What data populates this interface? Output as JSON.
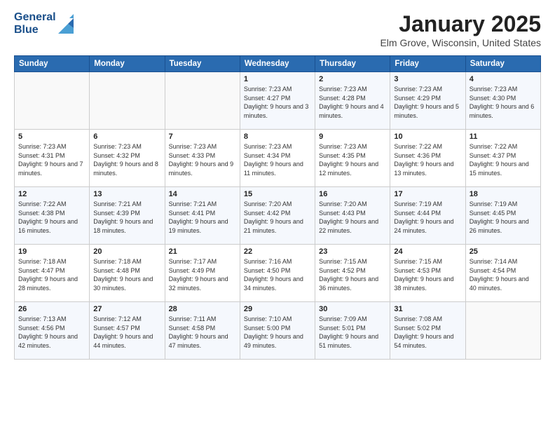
{
  "header": {
    "logo_line1": "General",
    "logo_line2": "Blue",
    "month_title": "January 2025",
    "location": "Elm Grove, Wisconsin, United States"
  },
  "days_of_week": [
    "Sunday",
    "Monday",
    "Tuesday",
    "Wednesday",
    "Thursday",
    "Friday",
    "Saturday"
  ],
  "weeks": [
    [
      {
        "day": "",
        "sunrise": "",
        "sunset": "",
        "daylight": ""
      },
      {
        "day": "",
        "sunrise": "",
        "sunset": "",
        "daylight": ""
      },
      {
        "day": "",
        "sunrise": "",
        "sunset": "",
        "daylight": ""
      },
      {
        "day": "1",
        "sunrise": "Sunrise: 7:23 AM",
        "sunset": "Sunset: 4:27 PM",
        "daylight": "Daylight: 9 hours and 3 minutes."
      },
      {
        "day": "2",
        "sunrise": "Sunrise: 7:23 AM",
        "sunset": "Sunset: 4:28 PM",
        "daylight": "Daylight: 9 hours and 4 minutes."
      },
      {
        "day": "3",
        "sunrise": "Sunrise: 7:23 AM",
        "sunset": "Sunset: 4:29 PM",
        "daylight": "Daylight: 9 hours and 5 minutes."
      },
      {
        "day": "4",
        "sunrise": "Sunrise: 7:23 AM",
        "sunset": "Sunset: 4:30 PM",
        "daylight": "Daylight: 9 hours and 6 minutes."
      }
    ],
    [
      {
        "day": "5",
        "sunrise": "Sunrise: 7:23 AM",
        "sunset": "Sunset: 4:31 PM",
        "daylight": "Daylight: 9 hours and 7 minutes."
      },
      {
        "day": "6",
        "sunrise": "Sunrise: 7:23 AM",
        "sunset": "Sunset: 4:32 PM",
        "daylight": "Daylight: 9 hours and 8 minutes."
      },
      {
        "day": "7",
        "sunrise": "Sunrise: 7:23 AM",
        "sunset": "Sunset: 4:33 PM",
        "daylight": "Daylight: 9 hours and 9 minutes."
      },
      {
        "day": "8",
        "sunrise": "Sunrise: 7:23 AM",
        "sunset": "Sunset: 4:34 PM",
        "daylight": "Daylight: 9 hours and 11 minutes."
      },
      {
        "day": "9",
        "sunrise": "Sunrise: 7:23 AM",
        "sunset": "Sunset: 4:35 PM",
        "daylight": "Daylight: 9 hours and 12 minutes."
      },
      {
        "day": "10",
        "sunrise": "Sunrise: 7:22 AM",
        "sunset": "Sunset: 4:36 PM",
        "daylight": "Daylight: 9 hours and 13 minutes."
      },
      {
        "day": "11",
        "sunrise": "Sunrise: 7:22 AM",
        "sunset": "Sunset: 4:37 PM",
        "daylight": "Daylight: 9 hours and 15 minutes."
      }
    ],
    [
      {
        "day": "12",
        "sunrise": "Sunrise: 7:22 AM",
        "sunset": "Sunset: 4:38 PM",
        "daylight": "Daylight: 9 hours and 16 minutes."
      },
      {
        "day": "13",
        "sunrise": "Sunrise: 7:21 AM",
        "sunset": "Sunset: 4:39 PM",
        "daylight": "Daylight: 9 hours and 18 minutes."
      },
      {
        "day": "14",
        "sunrise": "Sunrise: 7:21 AM",
        "sunset": "Sunset: 4:41 PM",
        "daylight": "Daylight: 9 hours and 19 minutes."
      },
      {
        "day": "15",
        "sunrise": "Sunrise: 7:20 AM",
        "sunset": "Sunset: 4:42 PM",
        "daylight": "Daylight: 9 hours and 21 minutes."
      },
      {
        "day": "16",
        "sunrise": "Sunrise: 7:20 AM",
        "sunset": "Sunset: 4:43 PM",
        "daylight": "Daylight: 9 hours and 22 minutes."
      },
      {
        "day": "17",
        "sunrise": "Sunrise: 7:19 AM",
        "sunset": "Sunset: 4:44 PM",
        "daylight": "Daylight: 9 hours and 24 minutes."
      },
      {
        "day": "18",
        "sunrise": "Sunrise: 7:19 AM",
        "sunset": "Sunset: 4:45 PM",
        "daylight": "Daylight: 9 hours and 26 minutes."
      }
    ],
    [
      {
        "day": "19",
        "sunrise": "Sunrise: 7:18 AM",
        "sunset": "Sunset: 4:47 PM",
        "daylight": "Daylight: 9 hours and 28 minutes."
      },
      {
        "day": "20",
        "sunrise": "Sunrise: 7:18 AM",
        "sunset": "Sunset: 4:48 PM",
        "daylight": "Daylight: 9 hours and 30 minutes."
      },
      {
        "day": "21",
        "sunrise": "Sunrise: 7:17 AM",
        "sunset": "Sunset: 4:49 PM",
        "daylight": "Daylight: 9 hours and 32 minutes."
      },
      {
        "day": "22",
        "sunrise": "Sunrise: 7:16 AM",
        "sunset": "Sunset: 4:50 PM",
        "daylight": "Daylight: 9 hours and 34 minutes."
      },
      {
        "day": "23",
        "sunrise": "Sunrise: 7:15 AM",
        "sunset": "Sunset: 4:52 PM",
        "daylight": "Daylight: 9 hours and 36 minutes."
      },
      {
        "day": "24",
        "sunrise": "Sunrise: 7:15 AM",
        "sunset": "Sunset: 4:53 PM",
        "daylight": "Daylight: 9 hours and 38 minutes."
      },
      {
        "day": "25",
        "sunrise": "Sunrise: 7:14 AM",
        "sunset": "Sunset: 4:54 PM",
        "daylight": "Daylight: 9 hours and 40 minutes."
      }
    ],
    [
      {
        "day": "26",
        "sunrise": "Sunrise: 7:13 AM",
        "sunset": "Sunset: 4:56 PM",
        "daylight": "Daylight: 9 hours and 42 minutes."
      },
      {
        "day": "27",
        "sunrise": "Sunrise: 7:12 AM",
        "sunset": "Sunset: 4:57 PM",
        "daylight": "Daylight: 9 hours and 44 minutes."
      },
      {
        "day": "28",
        "sunrise": "Sunrise: 7:11 AM",
        "sunset": "Sunset: 4:58 PM",
        "daylight": "Daylight: 9 hours and 47 minutes."
      },
      {
        "day": "29",
        "sunrise": "Sunrise: 7:10 AM",
        "sunset": "Sunset: 5:00 PM",
        "daylight": "Daylight: 9 hours and 49 minutes."
      },
      {
        "day": "30",
        "sunrise": "Sunrise: 7:09 AM",
        "sunset": "Sunset: 5:01 PM",
        "daylight": "Daylight: 9 hours and 51 minutes."
      },
      {
        "day": "31",
        "sunrise": "Sunrise: 7:08 AM",
        "sunset": "Sunset: 5:02 PM",
        "daylight": "Daylight: 9 hours and 54 minutes."
      },
      {
        "day": "",
        "sunrise": "",
        "sunset": "",
        "daylight": ""
      }
    ]
  ]
}
